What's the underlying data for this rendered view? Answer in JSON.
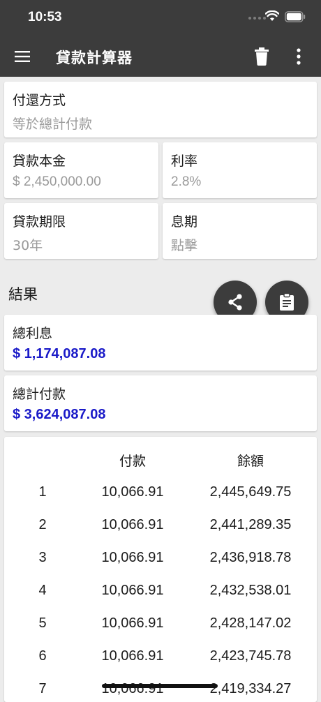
{
  "status_bar": {
    "time": "10:53"
  },
  "app_bar": {
    "title": "貸款計算器",
    "icons": [
      "menu-icon",
      "trash-icon",
      "more-vert-icon"
    ]
  },
  "inputs": {
    "payment_method": {
      "label": "付還方式",
      "value": "等於總計付款"
    },
    "principal": {
      "label": "貸款本金",
      "value": "$ 2,450,000.00"
    },
    "rate": {
      "label": "利率",
      "value": "2.8%"
    },
    "term": {
      "label": "貸款期限",
      "value": "30年"
    },
    "interest_period": {
      "label": "息期",
      "value": "點擊"
    }
  },
  "results": {
    "title": "結果",
    "total_interest": {
      "label": "總利息",
      "value": "$ 1,174,087.08"
    },
    "total_payment": {
      "label": "總計付款",
      "value": "$ 3,624,087.08"
    }
  },
  "fabs": {
    "share": "share-icon",
    "clipboard": "clipboard-icon"
  },
  "schedule": {
    "headers": [
      "",
      "付款",
      "餘額"
    ],
    "rows": [
      [
        "1",
        "10,066.91",
        "2,445,649.75"
      ],
      [
        "2",
        "10,066.91",
        "2,441,289.35"
      ],
      [
        "3",
        "10,066.91",
        "2,436,918.78"
      ],
      [
        "4",
        "10,066.91",
        "2,432,538.01"
      ],
      [
        "5",
        "10,066.91",
        "2,428,147.02"
      ],
      [
        "6",
        "10,066.91",
        "2,423,745.78"
      ],
      [
        "7",
        "10,066.91",
        "2,419,334.27"
      ]
    ]
  },
  "colors": {
    "app_bar": "#3c3c3c",
    "background": "#ececec",
    "result_value": "#1a1ac8",
    "hint_text": "#9a9a9a"
  }
}
